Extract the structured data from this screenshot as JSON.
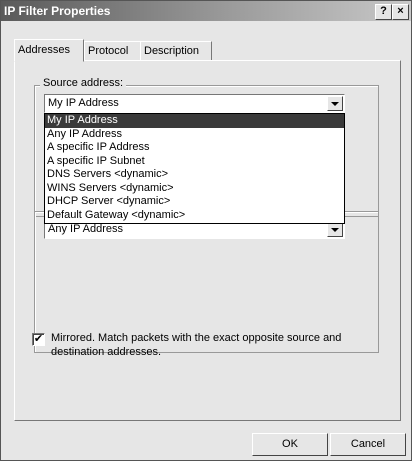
{
  "window": {
    "title": "IP Filter Properties",
    "help_button": "?",
    "close_button": "×"
  },
  "tabs": [
    {
      "label": "Addresses",
      "active": true
    },
    {
      "label": "Protocol",
      "active": false
    },
    {
      "label": "Description",
      "active": false
    }
  ],
  "source": {
    "group_label": "Source address:",
    "selected_value": "My IP Address",
    "options": [
      "My IP Address",
      "Any IP Address",
      "A specific IP Address",
      "A specific IP Subnet",
      "DNS Servers <dynamic>",
      "WINS Servers <dynamic>",
      "DHCP Server <dynamic>",
      "Default Gateway <dynamic>"
    ],
    "highlighted_option": "My IP Address"
  },
  "destination": {
    "selected_value": "Any IP Address"
  },
  "mirrored": {
    "checked": true,
    "check_glyph": "✔",
    "label": "Mirrored. Match packets with the exact opposite source and destination addresses."
  },
  "buttons": {
    "ok": "OK",
    "cancel": "Cancel"
  }
}
